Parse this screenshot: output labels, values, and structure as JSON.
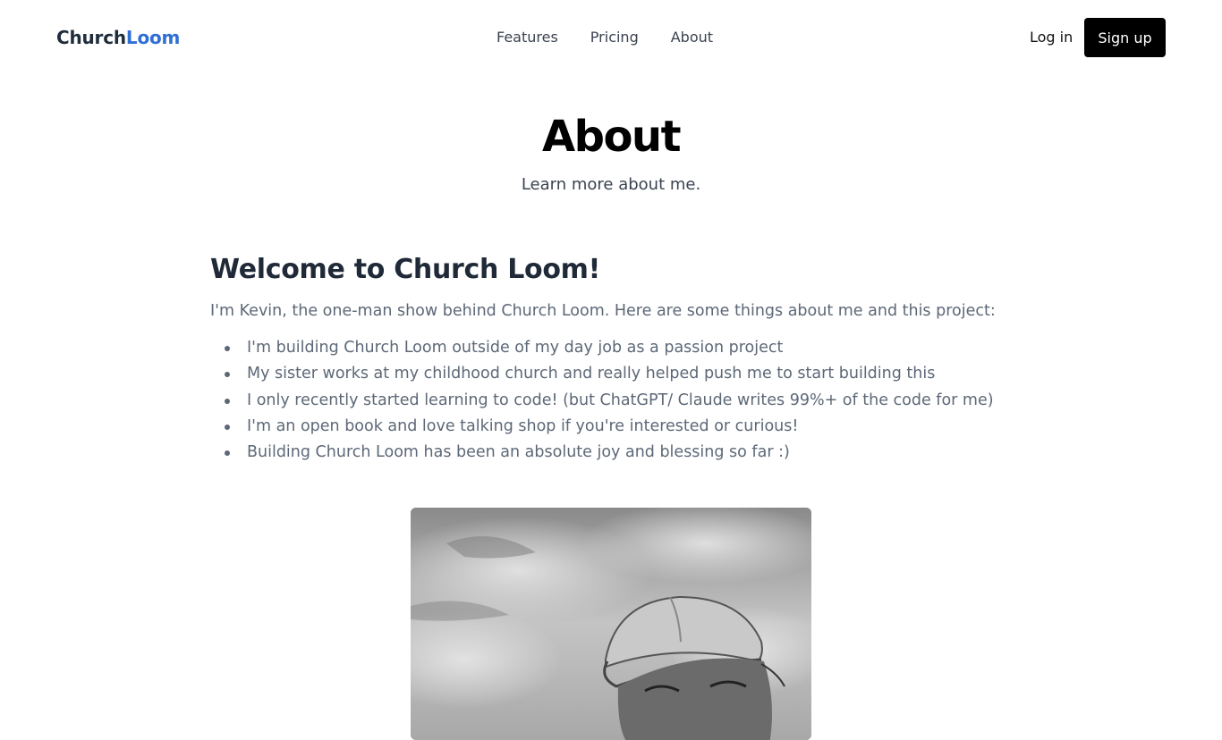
{
  "brand": {
    "part1": "Church",
    "part2": "Loom"
  },
  "nav": [
    {
      "label": "Features"
    },
    {
      "label": "Pricing"
    },
    {
      "label": "About"
    }
  ],
  "auth": {
    "login_label": "Log in",
    "signup_label": "Sign up"
  },
  "hero": {
    "title": "About",
    "subtitle": "Learn more about me."
  },
  "about": {
    "heading": "Welcome to Church Loom!",
    "intro": "I'm Kevin, the one-man show behind Church Loom. Here are some things about me and this project:",
    "items": [
      "I'm building Church Loom outside of my day job as a passion project",
      "My sister works at my childhood church and really helped push me to start building this",
      "I only recently started learning to code! (but ChatGPT/ Claude writes 99%+ of the code for me)",
      "I'm an open book and love talking shop if you're interested or curious!",
      "Building Church Loom has been an absolute joy and blessing so far :)"
    ]
  },
  "colors": {
    "brand_accent": "#2f6fd6",
    "signup_bg": "#000000",
    "body_text": "#5d6877"
  },
  "photo": {
    "icon": "profile-photo"
  }
}
